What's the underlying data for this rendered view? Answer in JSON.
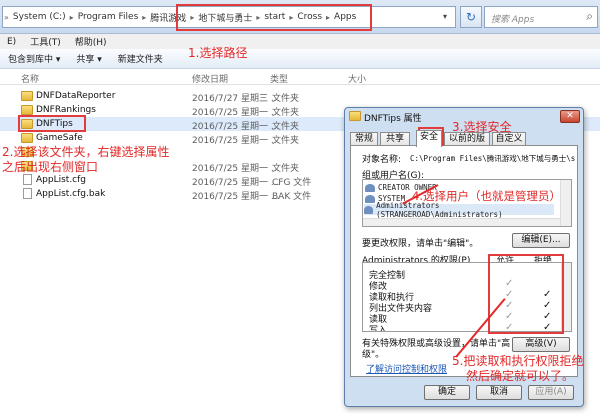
{
  "address": {
    "segments": [
      "System (C:)",
      "Program Files",
      "腾讯游戏",
      "地下城与勇士",
      "start",
      "Cross",
      "Apps"
    ],
    "lead_glyph": "»",
    "separator": "▸",
    "dropdown_glyph": "▾",
    "refresh_glyph": "↻",
    "search_placeholder": "搜索 Apps",
    "search_glyph": "⌕"
  },
  "menu": [
    "E)",
    "工具(T)",
    "帮助(H)"
  ],
  "toolbar": [
    "包含到库中 ▾",
    "共享 ▾",
    "新建文件夹"
  ],
  "columns": {
    "name": "名称",
    "date": "修改日期",
    "type": "类型",
    "size": "大小"
  },
  "files": [
    {
      "name": "DNFDataReporter",
      "date": "2016/7/27 星期三 ...",
      "type": "文件夹",
      "size": "",
      "kind": "folder"
    },
    {
      "name": "DNFRankings",
      "date": "2016/7/25 星期一 ...",
      "type": "文件夹",
      "size": "",
      "kind": "folder"
    },
    {
      "name": "DNFTips",
      "date": "2016/7/25 星期一 ...",
      "type": "文件夹",
      "size": "",
      "kind": "folder",
      "selected": true
    },
    {
      "name": "GameSafe",
      "date": "2016/7/25 星期一 ...",
      "type": "文件夹",
      "size": "",
      "kind": "folder"
    },
    {
      "name": "",
      "date": "",
      "type": "",
      "size": "",
      "kind": "folder"
    },
    {
      "name": "",
      "date": "2016/7/25 星期一 ...",
      "type": "文件夹",
      "size": "",
      "kind": "folder"
    },
    {
      "name": "AppList.cfg",
      "date": "2016/7/25 星期一 ...",
      "type": "CFG 文件",
      "size": "",
      "kind": "file"
    },
    {
      "name": "AppList.cfg.bak",
      "date": "2016/7/25 星期一 ...",
      "type": "BAK 文件",
      "size": "",
      "kind": "file"
    }
  ],
  "dialog": {
    "title": "DNFTips 属性",
    "close_glyph": "✕",
    "tabs": [
      "常规",
      "共享",
      "安全",
      "以前的版本",
      "自定义"
    ],
    "object_label": "对象名称:",
    "object_path": "C:\\Program Files\\腾讯游戏\\地下城与勇士\\s",
    "groups_label": "组或用户名(G):",
    "users": [
      "CREATOR OWNER",
      "SYSTEM",
      "Administrators (STRANGEROAD\\Administrators)"
    ],
    "change_hint": "要更改权限，请单击\"编辑\"。",
    "edit_button": "编辑(E)...",
    "perms_label": "Administrators 的权限(P)",
    "allow_header": "允许",
    "deny_header": "拒绝",
    "check_glyph": "✓",
    "permissions": [
      {
        "name": "完全控制",
        "allow": false,
        "deny": false
      },
      {
        "name": "修改",
        "allow": true,
        "deny": false
      },
      {
        "name": "读取和执行",
        "allow": true,
        "deny": true
      },
      {
        "name": "列出文件夹内容",
        "allow": true,
        "deny": true
      },
      {
        "name": "读取",
        "allow": true,
        "deny": true
      },
      {
        "name": "写入",
        "allow": true,
        "deny": true
      }
    ],
    "special_hint_1": "有关特殊权限或高级设置，请单击\"高",
    "special_hint_2": "级\"。",
    "advanced_button": "高级(V)",
    "link": "了解访问控制和权限",
    "ok_button": "确定",
    "cancel_button": "取消",
    "apply_button": "应用(A)"
  },
  "annotations": {
    "step1": "1.选择路径",
    "step2_line1": "2.选择该文件夹，右键选择属性",
    "step2_line2": "之后出现右侧窗口",
    "step3": "3.选择安全",
    "step4": "4.选择用户（也就是管理员）",
    "step5_line1": "5.把读取和执行权限拒绝",
    "step5_line2": "然后确定就可以了。"
  },
  "colors": {
    "annotation": "#e22828",
    "highlight_box": "#e23b3b",
    "link": "#1a56b8"
  }
}
